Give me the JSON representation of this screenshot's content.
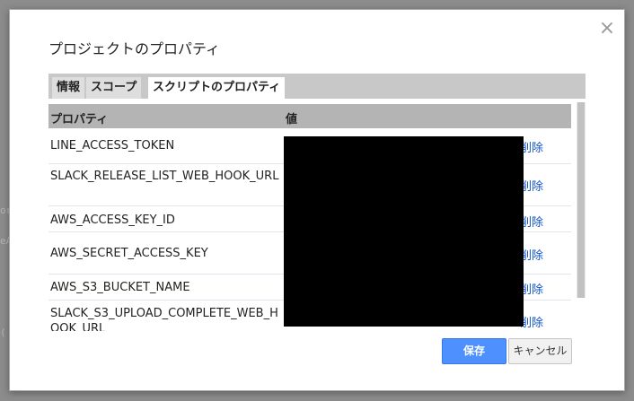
{
  "dialog": {
    "title": "プロジェクトのプロパティ",
    "close_icon": "close-x-icon"
  },
  "tabs": [
    {
      "label": "情報",
      "active": false
    },
    {
      "label": "スコープ",
      "active": false
    },
    {
      "label": "スクリプトのプロパティ",
      "active": true
    }
  ],
  "table": {
    "headers": {
      "property": "プロパティ",
      "value": "値"
    },
    "delete_label": "削除",
    "rows": [
      {
        "name": "LINE_ACCESS_TOKEN"
      },
      {
        "name": "SLACK_RELEASE_LIST_WEB_HOOK_URL"
      },
      {
        "name": "AWS_ACCESS_KEY_ID"
      },
      {
        "name": "AWS_SECRET_ACCESS_KEY"
      },
      {
        "name": "AWS_S3_BUCKET_NAME"
      },
      {
        "name": "SLACK_S3_UPLOAD_COMPLETE_WEB_HOOK_URL"
      }
    ]
  },
  "buttons": {
    "save": "保存",
    "cancel": "キャンセル"
  },
  "colors": {
    "save_button": "#4d90fe",
    "link": "#1155cc",
    "header_bg": "#b4b4b4"
  }
}
